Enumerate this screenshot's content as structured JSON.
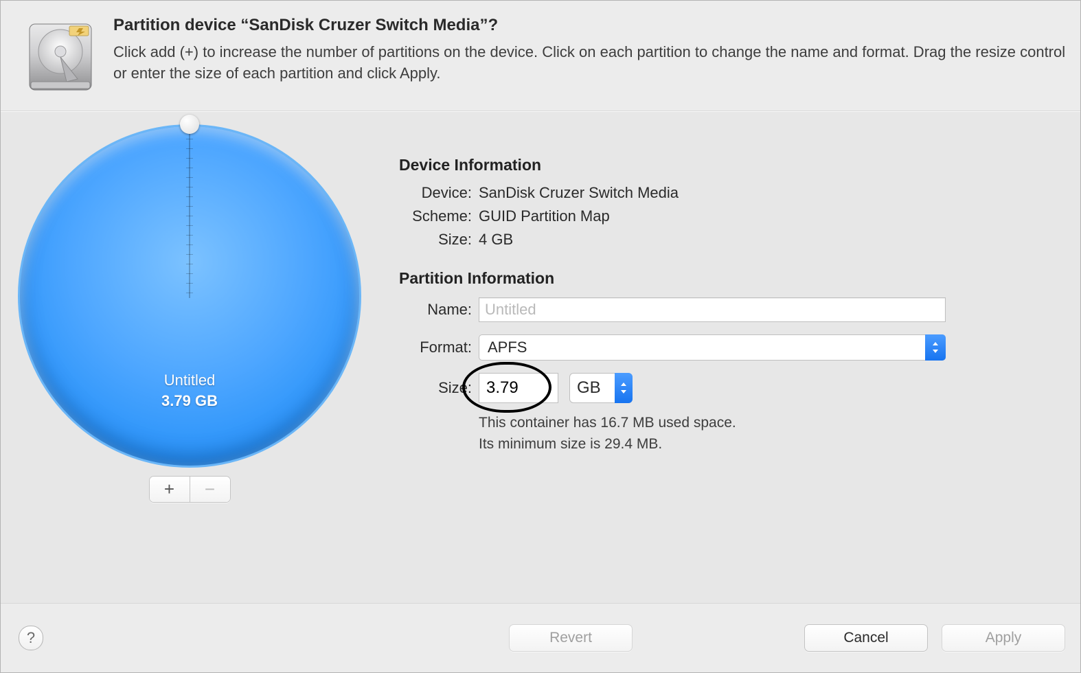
{
  "header": {
    "title": "Partition device “SanDisk Cruzer Switch Media”?",
    "description": "Click add (+) to increase the number of partitions on the device. Click on each partition to change the name and format. Drag the resize control or enter the size of each partition and click Apply."
  },
  "pie": {
    "partition_name": "Untitled",
    "partition_size_label": "3.79 GB"
  },
  "segmented": {
    "add_glyph": "+",
    "remove_glyph": "−"
  },
  "device_info": {
    "section_title": "Device Information",
    "device_label": "Device:",
    "device_value": "SanDisk Cruzer Switch Media",
    "scheme_label": "Scheme:",
    "scheme_value": "GUID Partition Map",
    "size_label": "Size:",
    "size_value": "4 GB"
  },
  "partition_info": {
    "section_title": "Partition Information",
    "name_label": "Name:",
    "name_value": "",
    "name_placeholder": "Untitled",
    "format_label": "Format:",
    "format_value": "APFS",
    "size_label": "Size:",
    "size_value": "3.79",
    "size_unit": "GB",
    "hint_line1": "This container has 16.7 MB used space.",
    "hint_line2": "Its minimum size is 29.4 MB."
  },
  "footer": {
    "help_glyph": "?",
    "revert_label": "Revert",
    "cancel_label": "Cancel",
    "apply_label": "Apply"
  },
  "chart_data": {
    "type": "pie",
    "title": "",
    "series": [
      {
        "name": "Untitled",
        "value": 3.79,
        "unit": "GB",
        "color": "#2f93f6"
      }
    ],
    "total": 3.79,
    "total_unit": "GB"
  }
}
